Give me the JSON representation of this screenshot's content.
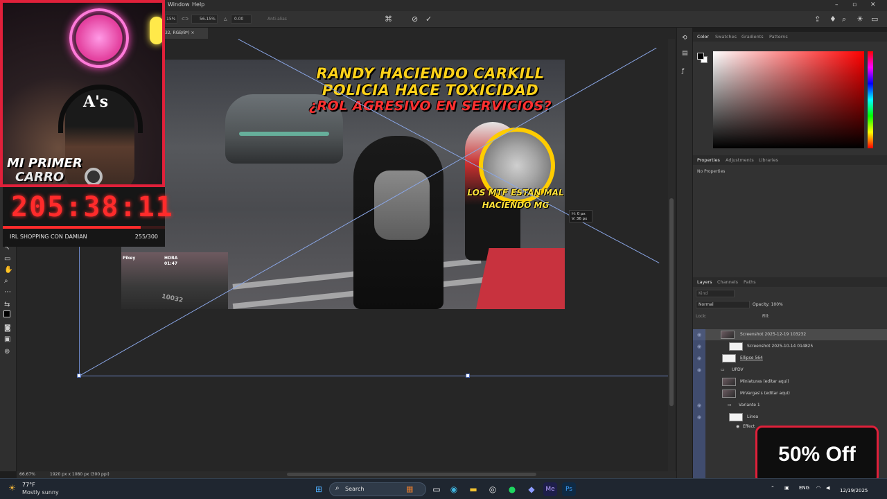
{
  "app": {
    "menu": [
      "Window",
      "Help"
    ],
    "doc_tab": "32, RGB/8*) ×",
    "zoom_status": "66.67%",
    "doc_size": "1920 px x 1080 px (300 ppi)"
  },
  "options_bar": {
    "w_value": "15%",
    "h_value": "56.15%",
    "angle": "0.00",
    "antialias": "Anti-alias"
  },
  "transform_tip": {
    "line1": "H: 0 px",
    "line2": "V: 36 px"
  },
  "thumbnail": {
    "title1": "RANDY HACIENDO CARKILL",
    "title2": "POLICIA HACE TOXICIDAD",
    "title3": "¿ROL AGRESIVO EN SERVICIOS?",
    "note1": "LOS MTF ESTAN MAL",
    "note2": "HACIENDO MG",
    "hud_name": "Pikey",
    "hud_label": "HORA",
    "hud_time": "01:47",
    "plate": "10032"
  },
  "color_panel": {
    "tabs": [
      "Color",
      "Swatches",
      "Gradients",
      "Patterns"
    ]
  },
  "properties_panel": {
    "tabs": [
      "Properties",
      "Adjustments",
      "Libraries"
    ],
    "empty_text": "No Properties"
  },
  "layers_panel": {
    "tabs": [
      "Layers",
      "Channels",
      "Paths"
    ],
    "kind": "Kind",
    "blend_mode": "Normal",
    "opacity": "Opacity: 100%",
    "lock": "Lock:",
    "fill": "Fill:",
    "layers": [
      {
        "name": "Screenshot 2025-12-19 103232",
        "selected": true
      },
      {
        "name": "Screenshot 2025-10-14 014825",
        "selected": false
      },
      {
        "name": "Ellipse 564",
        "selected": false
      },
      {
        "name": "UPDV",
        "selected": false
      },
      {
        "name": "Miniaturas (editar aqui)",
        "selected": false
      },
      {
        "name": "MrVargas's (editar aqui)",
        "selected": false
      },
      {
        "name": "Variante 1",
        "selected": false
      },
      {
        "name": "Linea",
        "selected": false
      },
      {
        "name": "Effect",
        "selected": false
      }
    ]
  },
  "webcam": {
    "cap_logo": "A's",
    "badge_line1": "MI PRIMER",
    "badge_line2": "CARRO"
  },
  "timer": {
    "value": "205:38:11",
    "label": "IRL SHOPPING CON DAMIAN",
    "count": "255/300",
    "progress": 0.85
  },
  "promo": {
    "text": "50% Off"
  },
  "taskbar": {
    "temp": "77°F",
    "weather": "Mostly sunny",
    "search": "Search",
    "lang": "ENG",
    "date": "12/19/2025"
  },
  "colors": {
    "accent_red": "#e0203a",
    "timer_red": "#ff2b2b",
    "title_yellow": "#ffd21a"
  }
}
